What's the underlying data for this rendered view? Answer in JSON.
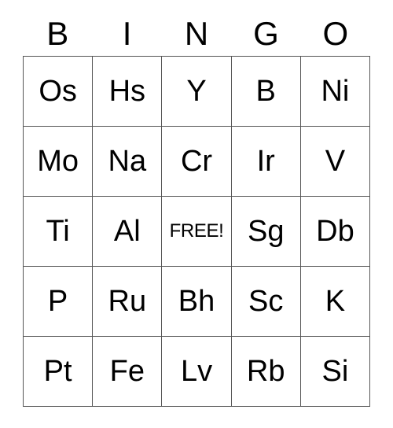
{
  "card": {
    "title": "BINGO",
    "headers": [
      "B",
      "I",
      "N",
      "G",
      "O"
    ],
    "free_space_label": "FREE!",
    "free_space_position": {
      "row": 2,
      "col": 2
    },
    "rows": [
      [
        "Os",
        "Hs",
        "Y",
        "B",
        "Ni"
      ],
      [
        "Mo",
        "Na",
        "Cr",
        "Ir",
        "V"
      ],
      [
        "Ti",
        "Al",
        "FREE!",
        "Sg",
        "Db"
      ],
      [
        "P",
        "Ru",
        "Bh",
        "Sc",
        "K"
      ],
      [
        "Pt",
        "Fe",
        "Lv",
        "Rb",
        "Si"
      ]
    ],
    "colors": {
      "text": "#000000",
      "border": "#555555",
      "background": "#ffffff"
    }
  }
}
